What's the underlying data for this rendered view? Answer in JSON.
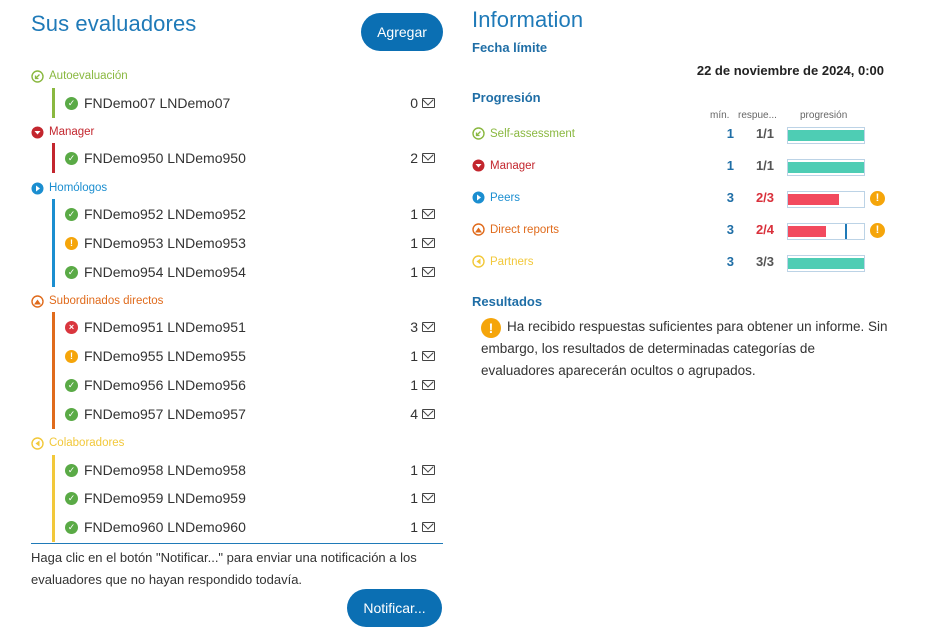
{
  "left": {
    "title": "Sus evaluadores",
    "add_label": "Agregar",
    "groups": [
      {
        "label": "Autoevaluación",
        "color": "#8ab840",
        "icon": "self-assessment-icon",
        "rows": [
          {
            "name": "FNDemo07 LNDemo07",
            "status": "ok",
            "count": "0"
          }
        ]
      },
      {
        "label": "Manager",
        "color": "#c3262e",
        "icon": "manager-icon",
        "rows": [
          {
            "name": "FNDemo950 LNDemo950",
            "status": "ok",
            "count": "2"
          }
        ]
      },
      {
        "label": "Homólogos",
        "color": "#1b8ed0",
        "icon": "peers-icon",
        "rows": [
          {
            "name": "FNDemo952 LNDemo952",
            "status": "ok",
            "count": "1"
          },
          {
            "name": "FNDemo953 LNDemo953",
            "status": "warn",
            "count": "1"
          },
          {
            "name": "FNDemo954 LNDemo954",
            "status": "ok",
            "count": "1"
          }
        ]
      },
      {
        "label": "Subordinados directos",
        "color": "#e06b1c",
        "icon": "direct-reports-icon",
        "rows": [
          {
            "name": "FNDemo951 LNDemo951",
            "status": "err",
            "count": "3"
          },
          {
            "name": "FNDemo955 LNDemo955",
            "status": "warn",
            "count": "1"
          },
          {
            "name": "FNDemo956 LNDemo956",
            "status": "ok",
            "count": "1"
          },
          {
            "name": "FNDemo957 LNDemo957",
            "status": "ok",
            "count": "4"
          }
        ]
      },
      {
        "label": "Colaboradores",
        "color": "#f2c83a",
        "icon": "partners-icon",
        "rows": [
          {
            "name": "FNDemo958 LNDemo958",
            "status": "ok",
            "count": "1"
          },
          {
            "name": "FNDemo959 LNDemo959",
            "status": "ok",
            "count": "1"
          },
          {
            "name": "FNDemo960 LNDemo960",
            "status": "ok",
            "count": "1"
          }
        ]
      }
    ],
    "note": "Haga clic en el botón \"Notificar...\" para enviar una notificación a los evaluadores que no hayan respondido todavía.",
    "notify_label": "Notificar..."
  },
  "right": {
    "title": "Information",
    "deadline_heading": "Fecha límite",
    "deadline_value": "22 de noviembre de 2024, 0:00",
    "progress_heading": "Progresión",
    "columns": {
      "min": "mín.",
      "resp": "respue...",
      "prog": "progresión"
    },
    "progress": [
      {
        "label": "Self-assessment",
        "color": "#8ab840",
        "icon": "self-assessment-icon",
        "min": "1",
        "resp": "1/1",
        "fraction": 1.0,
        "warn": false,
        "bar_color": "#4ecdb4",
        "marker": null
      },
      {
        "label": "Manager",
        "color": "#c3262e",
        "icon": "manager-icon",
        "min": "1",
        "resp": "1/1",
        "fraction": 1.0,
        "warn": false,
        "bar_color": "#4ecdb4",
        "marker": null
      },
      {
        "label": "Peers",
        "color": "#1b8ed0",
        "icon": "peers-icon",
        "min": "3",
        "resp": "2/3",
        "fraction": 0.667,
        "warn": true,
        "bar_color": "#f24a5e",
        "marker": null
      },
      {
        "label": "Direct reports",
        "color": "#e06b1c",
        "icon": "direct-reports-icon",
        "min": "3",
        "resp": "2/4",
        "fraction": 0.5,
        "warn": true,
        "bar_color": "#f24a5e",
        "marker": 0.75
      },
      {
        "label": "Partners",
        "color": "#f2c83a",
        "icon": "partners-icon",
        "min": "3",
        "resp": "3/3",
        "fraction": 1.0,
        "warn": false,
        "bar_color": "#4ecdb4",
        "marker": null
      }
    ],
    "results_heading": "Resultados",
    "results_text": "Ha recibido respuestas suficientes para obtener un informe. Sin embargo, los resultados de determinadas categorías de evaluadores aparecerán ocultos o agrupados."
  }
}
